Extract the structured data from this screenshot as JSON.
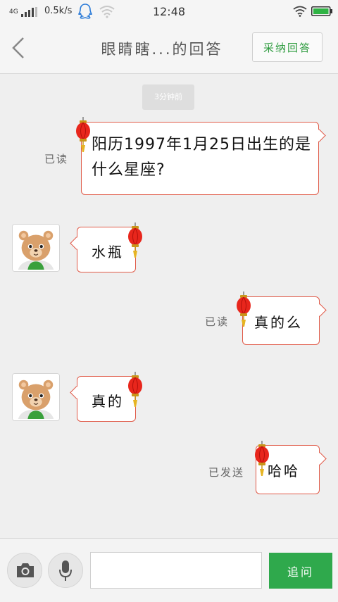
{
  "status_bar": {
    "network": "4G",
    "speed": "0.5k/s",
    "time": "12:48"
  },
  "header": {
    "title": "眼睛瞎...的回答",
    "accept_label": "采纳回答"
  },
  "chat": {
    "timestamp": "3分钟前",
    "messages": [
      {
        "side": "right",
        "status": "已读",
        "text": "阳历1997年1月25日出生的是什么星座?"
      },
      {
        "side": "left",
        "text": "水瓶"
      },
      {
        "side": "right",
        "status": "已读",
        "text": "真的么"
      },
      {
        "side": "left",
        "text": "真的"
      },
      {
        "side": "right",
        "status": "已发送",
        "text": "哈哈"
      }
    ]
  },
  "input_bar": {
    "placeholder": "",
    "send_label": "追问"
  },
  "icons": {
    "camera": "camera-icon",
    "microphone": "microphone-icon",
    "lantern": "lantern-icon",
    "avatar": "bear-avatar"
  },
  "colors": {
    "bubble_border": "#e05a48",
    "accent_green": "#2fa94c",
    "lantern_red": "#e8261c"
  }
}
